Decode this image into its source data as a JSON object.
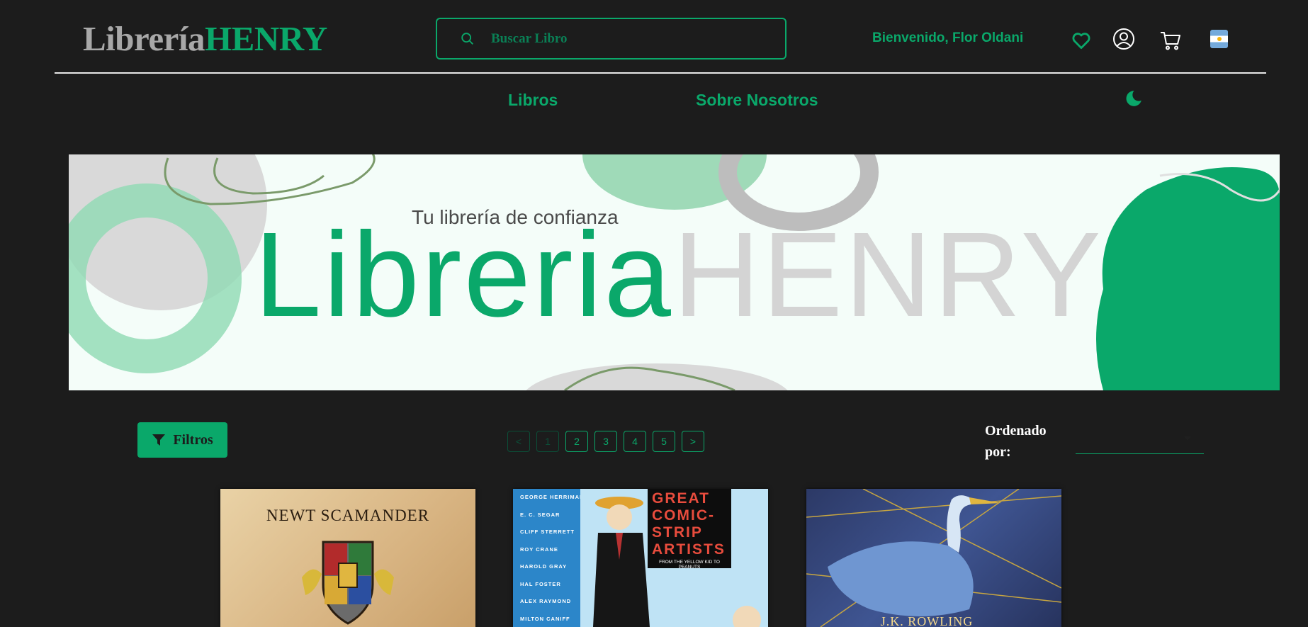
{
  "header": {
    "logo_part1": "Librería",
    "logo_part2": "HENRY",
    "search_placeholder": "Buscar Libro",
    "welcome": "Bienvenido, Flor Oldani",
    "icons": [
      "search-icon",
      "heart-icon",
      "user-icon",
      "cart-icon",
      "argentina-flag-icon"
    ]
  },
  "nav": {
    "libros": "Libros",
    "sobre": "Sobre Nosotros",
    "theme_icon": "moon-icon"
  },
  "banner": {
    "tagline": "Tu librería de confianza",
    "title_part1": "Libreria",
    "title_part2": "HENRY"
  },
  "controls": {
    "filter_label": "Filtros",
    "pages": [
      "<",
      "1",
      "2",
      "3",
      "4",
      "5",
      ">"
    ],
    "current_page": "1",
    "order_label": "Ordenado por:",
    "order_value": ""
  },
  "books": [
    {
      "cover_title": "NEWT SCAMANDER"
    },
    {
      "cover_names": [
        "GEORGE HERRIMAN",
        "E. C. SEGAR",
        "CLIFF STERRETT",
        "ROY CRANE",
        "HAROLD GRAY",
        "HAL FOSTER",
        "ALEX RAYMOND",
        "MILTON CANIFF"
      ],
      "cover_title": "GREAT COMIC-STRIP ARTISTS",
      "cover_subtitle": "FROM THE YELLOW KID TO PEANUTS"
    },
    {
      "cover_author": "J.K. ROWLING"
    }
  ],
  "colors": {
    "accent": "#0aa86a",
    "background": "#1c1c1c",
    "logo_grey": "#a8a8a8"
  }
}
